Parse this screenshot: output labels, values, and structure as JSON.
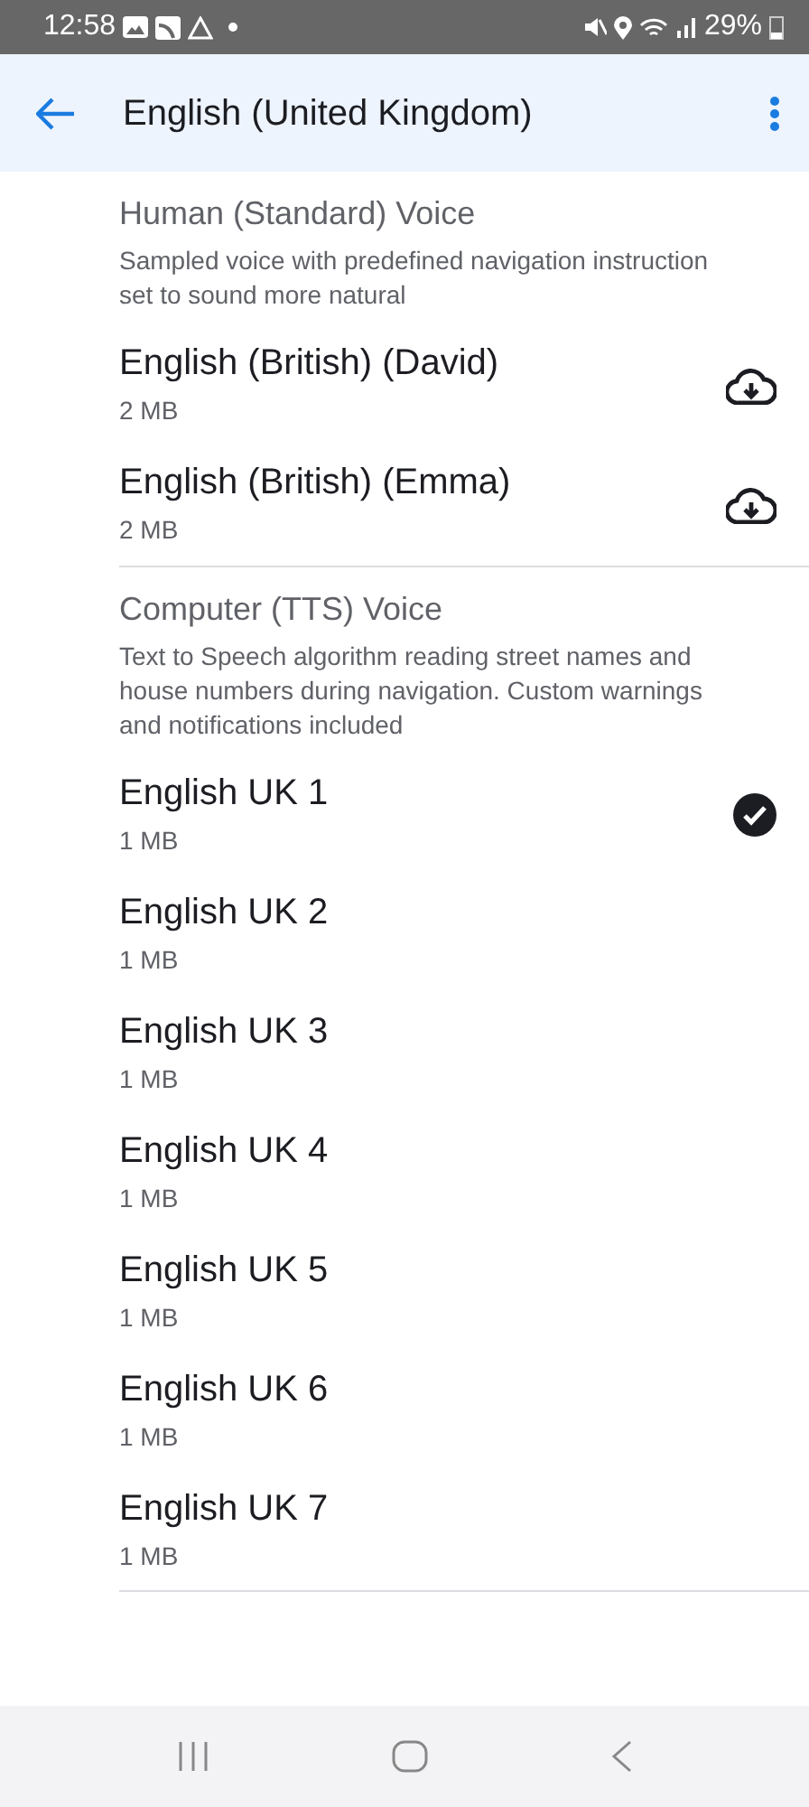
{
  "status_bar": {
    "time": "12:58",
    "battery": "29%"
  },
  "header": {
    "title": "English (United Kingdom)"
  },
  "sections": [
    {
      "title": "Human (Standard) Voice",
      "description": "Sampled voice with predefined navigation instruction set to sound more natural",
      "items": [
        {
          "name": "English (British) (David)",
          "size": "2 MB",
          "downloaded": false,
          "selected": false
        },
        {
          "name": "English (British) (Emma)",
          "size": "2 MB",
          "downloaded": false,
          "selected": false
        }
      ]
    },
    {
      "title": "Computer (TTS) Voice",
      "description": "Text to Speech algorithm reading street names and house numbers during navigation. Custom warnings and notifications included",
      "items": [
        {
          "name": "English UK 1",
          "size": "1 MB",
          "downloaded": true,
          "selected": true
        },
        {
          "name": "English UK 2",
          "size": "1 MB",
          "downloaded": true,
          "selected": false
        },
        {
          "name": "English UK 3",
          "size": "1 MB",
          "downloaded": true,
          "selected": false
        },
        {
          "name": "English UK 4",
          "size": "1 MB",
          "downloaded": true,
          "selected": false
        },
        {
          "name": "English UK 5",
          "size": "1 MB",
          "downloaded": true,
          "selected": false
        },
        {
          "name": "English UK 6",
          "size": "1 MB",
          "downloaded": true,
          "selected": false
        },
        {
          "name": "English UK 7",
          "size": "1 MB",
          "downloaded": true,
          "selected": false
        }
      ]
    }
  ]
}
